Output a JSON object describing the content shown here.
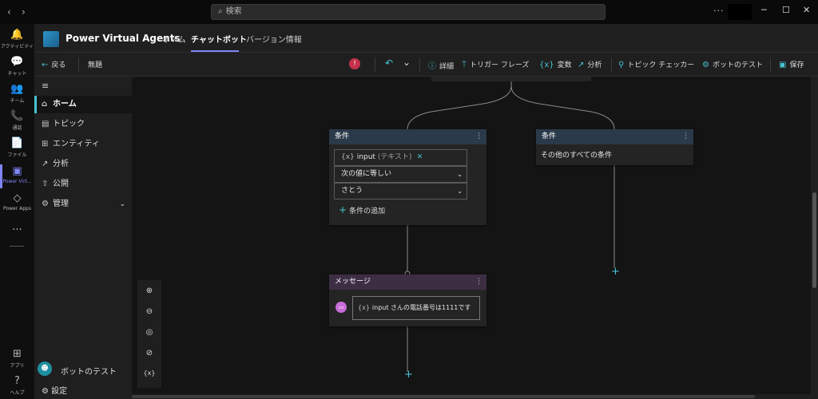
{
  "titlebar": {
    "search_placeholder": "検索",
    "back_arrow": "‹",
    "forward_arrow": "›",
    "more": "···",
    "minimize": "─",
    "maximize": "☐",
    "close": "✕"
  },
  "rail": [
    {
      "icon": "🔔",
      "label": "アクティビティ"
    },
    {
      "icon": "💬",
      "label": "チャット"
    },
    {
      "icon": "👥",
      "label": "チーム"
    },
    {
      "icon": "📞",
      "label": "通話"
    },
    {
      "icon": "📄",
      "label": "ファイル"
    },
    {
      "icon": "▣",
      "label": "Power Virt..."
    },
    {
      "icon": "◇",
      "label": "Power Apps"
    },
    {
      "icon": "···",
      "label": ""
    },
    {
      "icon": "⊞",
      "label": "アプリ"
    },
    {
      "icon": "?",
      "label": "ヘルプ"
    }
  ],
  "header": {
    "app_title": "Power Virtual Agents",
    "tabs": [
      "ホーム",
      "チャットボット",
      "バージョン情報"
    ]
  },
  "commandbar": {
    "back": "戻る",
    "topic_name": "無題",
    "undo": "↶",
    "dropdown": "⌄",
    "details": "詳細",
    "trigger": "トリガー フレーズ",
    "variables": "変数",
    "analytics": "分析",
    "topic_checker": "トピック チェッカー",
    "test_bot": "ボットのテスト",
    "save": "保存",
    "error_icon": "!"
  },
  "sidebar": {
    "menu": "≡",
    "items": [
      {
        "icon": "⌂",
        "label": "ホーム"
      },
      {
        "icon": "▤",
        "label": "トピック"
      },
      {
        "icon": "⊞",
        "label": "エンティティ"
      },
      {
        "icon": "↗",
        "label": "分析"
      },
      {
        "icon": "⇧",
        "label": "公開"
      },
      {
        "icon": "⚙",
        "label": "管理"
      }
    ],
    "manage_chevron": "⌄",
    "bot_test": "ボットのテスト",
    "settings": "設定",
    "settings_icon": "⚙"
  },
  "canvas": {
    "condition_node": {
      "title": "条件",
      "variable_chip": "{x}",
      "variable_name": "input",
      "variable_type": "(テキスト)",
      "remove": "✕",
      "operator": "次の値に等しい",
      "value": "さとう",
      "add_condition": "条件の追加",
      "menu": "⋮"
    },
    "other_node": {
      "title": "条件",
      "text": "その他のすべての条件",
      "menu": "⋮"
    },
    "message_node": {
      "title": "メッセージ",
      "chip": "{x}",
      "text": "input さんの電話番号は1111です",
      "menu": "⋮"
    },
    "add_plus": "+",
    "zoom": [
      {
        "name": "zoom-in-icon",
        "glyph": "⊕"
      },
      {
        "name": "zoom-out-icon",
        "glyph": "⊖"
      },
      {
        "name": "fit-view-icon",
        "glyph": "◎"
      },
      {
        "name": "reset-view-icon",
        "glyph": "⊘"
      },
      {
        "name": "variables-icon",
        "glyph": "{x}"
      }
    ]
  },
  "colors": {
    "accent": "#7f85f5",
    "teal": "#47c4d4",
    "condition_header": "#2b3a4a",
    "message_header": "#3d2e44",
    "error": "#c4314b"
  }
}
